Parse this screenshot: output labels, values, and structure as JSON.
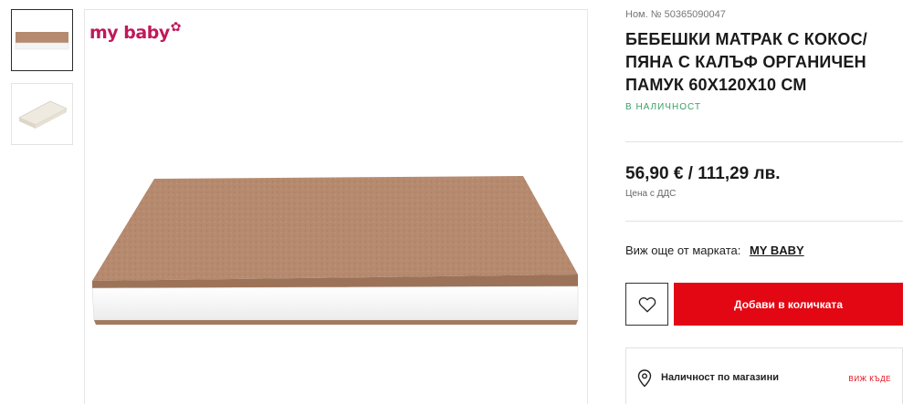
{
  "gallery": {
    "brand_logo": "my baby",
    "thumbnails": [
      "mattress-side-view",
      "mattress-angled-view"
    ],
    "active_index": 0
  },
  "product": {
    "sku": "Ном. № 50365090047",
    "title": "БЕБЕШКИ МАТРАК С КОКОС/ ПЯНА С КАЛЪФ ОРГАНИЧЕН ПАМУК 60X120X10 СМ",
    "stock_status": "В НАЛИЧНОСТ",
    "price": "56,90 € / 111,29 лв.",
    "price_note": "Цена с ДДС",
    "brand_prefix": "Виж още от марката:",
    "brand_name": "MY BABY"
  },
  "actions": {
    "wishlist_icon": "heart-icon",
    "add_to_cart": "Добави в количката"
  },
  "stores": {
    "icon": "location-pin-icon",
    "label": "Наличност по магазини",
    "link": "ВИЖ КЪДЕ"
  },
  "colors": {
    "accent": "#e30613",
    "stock": "#3aa067",
    "brand_logo": "#c2185b",
    "coir": "#b58a6e",
    "foam": "#f7f7f7"
  }
}
